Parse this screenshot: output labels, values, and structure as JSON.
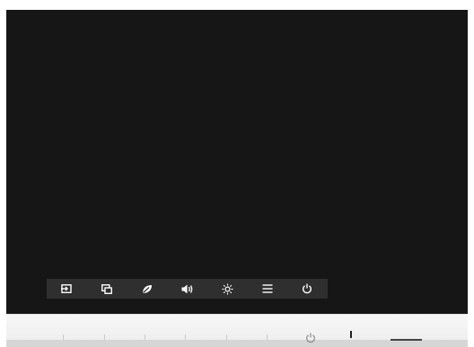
{
  "screen": {
    "background": "#161616"
  },
  "osd_menu": {
    "background": "#2f2f2f",
    "icon_color": "#ffffff",
    "buttons": [
      {
        "icon": "input-source-icon"
      },
      {
        "icon": "picture-in-picture-icon"
      },
      {
        "icon": "eco-mode-icon"
      },
      {
        "icon": "volume-icon"
      },
      {
        "icon": "brightness-icon"
      },
      {
        "icon": "menu-icon"
      },
      {
        "icon": "power-icon"
      }
    ]
  },
  "bezel": {
    "color": "#f2f2f2",
    "hardware_buttons": [
      {
        "icon": "hardware-button-1"
      },
      {
        "icon": "hardware-button-2"
      },
      {
        "icon": "hardware-button-3"
      },
      {
        "icon": "hardware-button-4"
      },
      {
        "icon": "hardware-button-5"
      },
      {
        "icon": "hardware-button-6"
      },
      {
        "icon": "hardware-power-icon"
      }
    ],
    "power_led_color": "#222222"
  }
}
